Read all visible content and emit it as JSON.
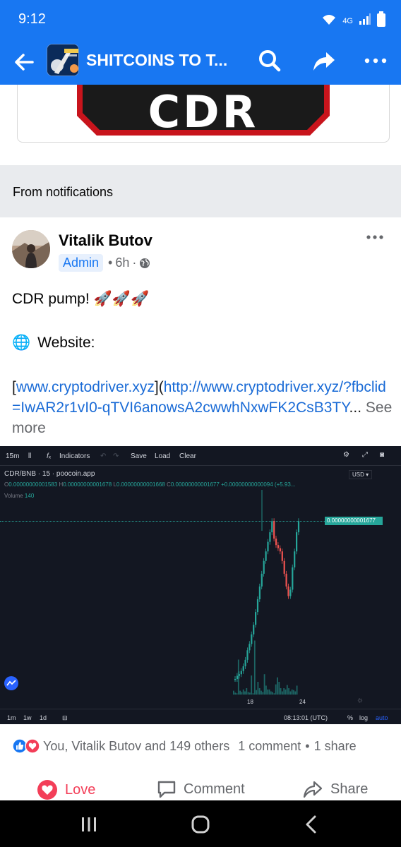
{
  "status": {
    "time": "9:12",
    "network": "4G"
  },
  "appbar": {
    "title": "SHITCOINS TO T..."
  },
  "prev_post": {
    "banner_text": "CDR"
  },
  "section": {
    "label": "From notifications"
  },
  "post": {
    "author": "Vitalik Butov",
    "badge": "Admin",
    "time": "6h",
    "text_line1": "CDR pump!",
    "emoji_rockets": "🚀🚀🚀",
    "globe": "🌐",
    "website_label": "Website:",
    "link_bracket_open": "[",
    "link_text": "www.cryptodriver.xyz",
    "link_middle": "](",
    "link_url": "http://www.cryptodriver.xyz/?fbclid=IwAR2r1vI0-qTVI6anowsA2cwwhNxwFK2CsB3TY",
    "ellipsis": "...",
    "see_more": "See more"
  },
  "chart": {
    "toolbar": {
      "interval": "15m",
      "indicators": "Indicators",
      "save": "Save",
      "load": "Load",
      "clear": "Clear"
    },
    "symbol": "CDR/BNB · 15 · poocoin.app",
    "ohlc": {
      "o_label": "O",
      "o": "0.00000000001583",
      "h_label": "H",
      "h": "0.00000000001678",
      "l_label": "L",
      "l": "0.00000000001668",
      "c_label": "C",
      "c": "0.00000000001677",
      "change": "+0.00000000000094 (+5.93..."
    },
    "volume_label": "Volume",
    "volume_value": "140",
    "currency": "USD",
    "last_price": "0.00000000001677",
    "x_ticks": [
      "18",
      "24"
    ],
    "ranges": [
      "1m",
      "1w",
      "1d"
    ],
    "clock": "08:13:01 (UTC)",
    "scale_opts": [
      "%",
      "log",
      "auto"
    ]
  },
  "chart_data": {
    "type": "candlestick",
    "title": "",
    "xlabel": "",
    "ylabel": "",
    "x_ticks": [
      "18",
      "24"
    ],
    "last_price": 1.677e-11,
    "candles_up_color": "#26a69a",
    "candles_down_color": "#ef5350",
    "volume_shape": [
      0.06,
      0.03,
      0.02,
      0.55,
      0.06,
      0.04,
      0.08,
      0.05,
      0.1,
      0.04,
      0.03,
      0.3,
      0.02,
      0.85,
      0.07,
      0.2,
      0.1,
      0.06,
      0.04,
      0.32,
      0.14,
      0.08,
      0.08,
      0.05,
      0.04,
      0.02,
      0.16,
      0.27,
      0.2,
      0.1,
      0.05,
      0.1,
      0.08,
      0.15,
      0.1,
      0.05,
      0.08,
      0.07,
      0.05,
      0.14
    ]
  },
  "reactions": {
    "summary": "You, Vitalik Butov and 149 others",
    "comments": "1 comment",
    "separator": "•",
    "shares": "1 share"
  },
  "actions": {
    "love": "Love",
    "comment": "Comment",
    "share": "Share"
  },
  "colors": {
    "brand": "#1877f2",
    "love": "#f33e58",
    "chart_bg": "#131722",
    "up": "#26a69a",
    "down": "#ef5350"
  }
}
